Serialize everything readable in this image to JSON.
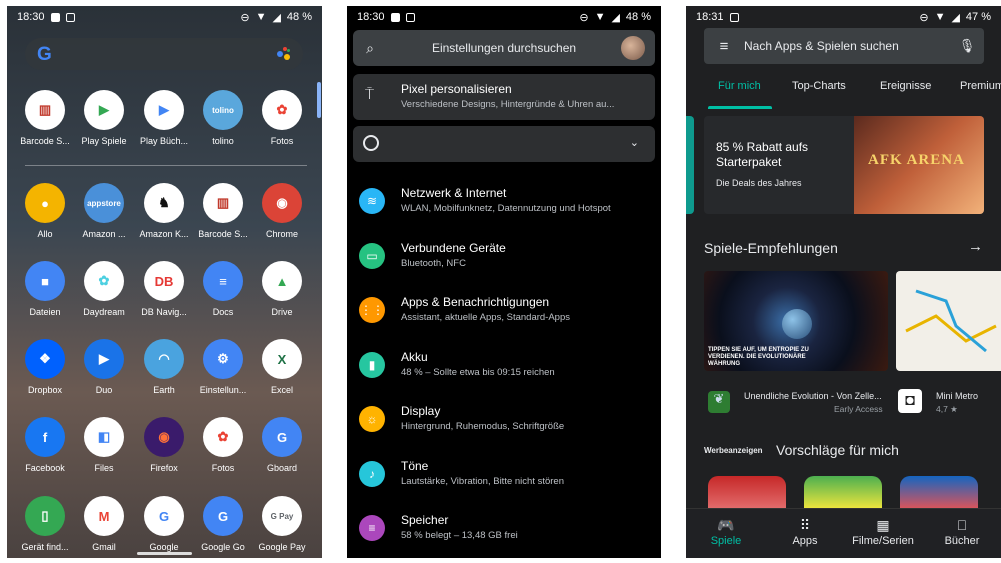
{
  "phone1": {
    "status": {
      "time": "18:30",
      "battery": "48 %"
    },
    "search": {
      "logo": "G"
    },
    "apps": [
      {
        "label": "Barcode S...",
        "color": "#ffffff",
        "glyph": "▥",
        "glyph_color": "#c0392b"
      },
      {
        "label": "Play Spiele",
        "color": "#ffffff",
        "glyph": "▶",
        "glyph_color": "#34a853"
      },
      {
        "label": "Play Büch...",
        "color": "#ffffff",
        "glyph": "▶",
        "glyph_color": "#4285f4"
      },
      {
        "label": "tolino",
        "color": "#5aa7dc",
        "glyph": "tolino",
        "glyph_color": "#ffffff"
      },
      {
        "label": "Fotos",
        "color": "#ffffff",
        "glyph": "✿",
        "glyph_color": "#ea4335"
      },
      {
        "label": "Allo",
        "color": "#f4b400",
        "glyph": "●",
        "glyph_color": "#ffffff"
      },
      {
        "label": "Amazon ...",
        "color": "#4a90d9",
        "glyph": "appstore",
        "glyph_color": "#ffffff"
      },
      {
        "label": "Amazon K...",
        "color": "#ffffff",
        "glyph": "♞",
        "glyph_color": "#111111"
      },
      {
        "label": "Barcode S...",
        "color": "#ffffff",
        "glyph": "▥",
        "glyph_color": "#c0392b"
      },
      {
        "label": "Chrome",
        "color": "#db4437",
        "glyph": "◉",
        "glyph_color": "#ffffff"
      },
      {
        "label": "Dateien",
        "color": "#4285f4",
        "glyph": "■",
        "glyph_color": "#ffffff"
      },
      {
        "label": "Daydream",
        "color": "#ffffff",
        "glyph": "✿",
        "glyph_color": "#4dd0e1"
      },
      {
        "label": "DB Navig...",
        "color": "#ffffff",
        "glyph": "DB",
        "glyph_color": "#e53935"
      },
      {
        "label": "Docs",
        "color": "#4285f4",
        "glyph": "≡",
        "glyph_color": "#ffffff"
      },
      {
        "label": "Drive",
        "color": "#ffffff",
        "glyph": "▲",
        "glyph_color": "#34a853"
      },
      {
        "label": "Dropbox",
        "color": "#0061fe",
        "glyph": "❖",
        "glyph_color": "#ffffff"
      },
      {
        "label": "Duo",
        "color": "#1a73e8",
        "glyph": "▶",
        "glyph_color": "#ffffff"
      },
      {
        "label": "Earth",
        "color": "#4aa3df",
        "glyph": "◠",
        "glyph_color": "#ffffff"
      },
      {
        "label": "Einstellun...",
        "color": "#4285f4",
        "glyph": "⚙",
        "glyph_color": "#ffffff"
      },
      {
        "label": "Excel",
        "color": "#ffffff",
        "glyph": "X",
        "glyph_color": "#1e7145"
      },
      {
        "label": "Facebook",
        "color": "#1877f2",
        "glyph": "f",
        "glyph_color": "#ffffff"
      },
      {
        "label": "Files",
        "color": "#ffffff",
        "glyph": "◧",
        "glyph_color": "#4285f4"
      },
      {
        "label": "Firefox",
        "color": "#3a1b6b",
        "glyph": "◉",
        "glyph_color": "#ff7139"
      },
      {
        "label": "Fotos",
        "color": "#ffffff",
        "glyph": "✿",
        "glyph_color": "#ea4335"
      },
      {
        "label": "Gboard",
        "color": "#4285f4",
        "glyph": "G",
        "glyph_color": "#ffffff"
      },
      {
        "label": "Gerät find...",
        "color": "#34a853",
        "glyph": "▯",
        "glyph_color": "#ffffff"
      },
      {
        "label": "Gmail",
        "color": "#ffffff",
        "glyph": "M",
        "glyph_color": "#ea4335"
      },
      {
        "label": "Google",
        "color": "#ffffff",
        "glyph": "G",
        "glyph_color": "#4285f4"
      },
      {
        "label": "Google Go",
        "color": "#4285f4",
        "glyph": "G",
        "glyph_color": "#ffffff"
      },
      {
        "label": "Google Pay",
        "color": "#ffffff",
        "glyph": "G Pay",
        "glyph_color": "#5f6368"
      }
    ]
  },
  "phone2": {
    "status": {
      "time": "18:30",
      "battery": "48 %"
    },
    "search": {
      "placeholder": "Einstellungen durchsuchen"
    },
    "pixel_card": {
      "title": "Pixel personalisieren",
      "subtitle": "Verschiedene Designs, Hintergründe & Uhren au..."
    },
    "rows": [
      {
        "title": "Netzwerk & Internet",
        "subtitle": "WLAN, Mobilfunknetz, Datennutzung und Hotspot",
        "color": "#29b6f6",
        "icon": "wifi-icon",
        "glyph": "≋"
      },
      {
        "title": "Verbundene Geräte",
        "subtitle": "Bluetooth, NFC",
        "color": "#26c281",
        "icon": "devices-icon",
        "glyph": "▭"
      },
      {
        "title": "Apps & Benachrichtigungen",
        "subtitle": "Assistant, aktuelle Apps, Standard-Apps",
        "color": "#ff9800",
        "icon": "apps-icon",
        "glyph": "⋮⋮"
      },
      {
        "title": "Akku",
        "subtitle": "48 % – Sollte etwa bis 09:15 reichen",
        "color": "#26c6a0",
        "icon": "battery-icon",
        "glyph": "▮"
      },
      {
        "title": "Display",
        "subtitle": "Hintergrund, Ruhemodus, Schriftgröße",
        "color": "#ffb300",
        "icon": "brightness-icon",
        "glyph": "☼"
      },
      {
        "title": "Töne",
        "subtitle": "Lautstärke, Vibration, Bitte nicht stören",
        "color": "#26c6da",
        "icon": "sound-icon",
        "glyph": "♪"
      },
      {
        "title": "Speicher",
        "subtitle": "58 % belegt – 13,48 GB frei",
        "color": "#ab47bc",
        "icon": "storage-icon",
        "glyph": "≡"
      }
    ]
  },
  "phone3": {
    "status": {
      "time": "18:31",
      "battery": "47 %"
    },
    "search": {
      "placeholder": "Nach Apps & Spielen suchen"
    },
    "tabs": [
      "Für mich",
      "Top-Charts",
      "Ereignisse",
      "Premium"
    ],
    "promo": {
      "title": "85 % Rabatt aufs Starterpaket",
      "subtitle": "Die Deals des Jahres",
      "game_logo": "AFK ARENA"
    },
    "section1": "Spiele-Empfehlungen",
    "card_text": "TIPPEN SIE AUF, UM ENTROPIE ZU VERDIENEN. DIE EVOLUTIONÄRE WÄHRUNG",
    "games": [
      {
        "name": "Unendliche Evolution - Von Zelle...",
        "meta": "Early Access"
      },
      {
        "name": "Mini Metro",
        "meta": "4,7 ★"
      }
    ],
    "ads_label": "Werbeanzeigen",
    "section2": "Vorschläge für mich",
    "nav": [
      "Spiele",
      "Apps",
      "Filme/Serien",
      "Bücher"
    ]
  }
}
